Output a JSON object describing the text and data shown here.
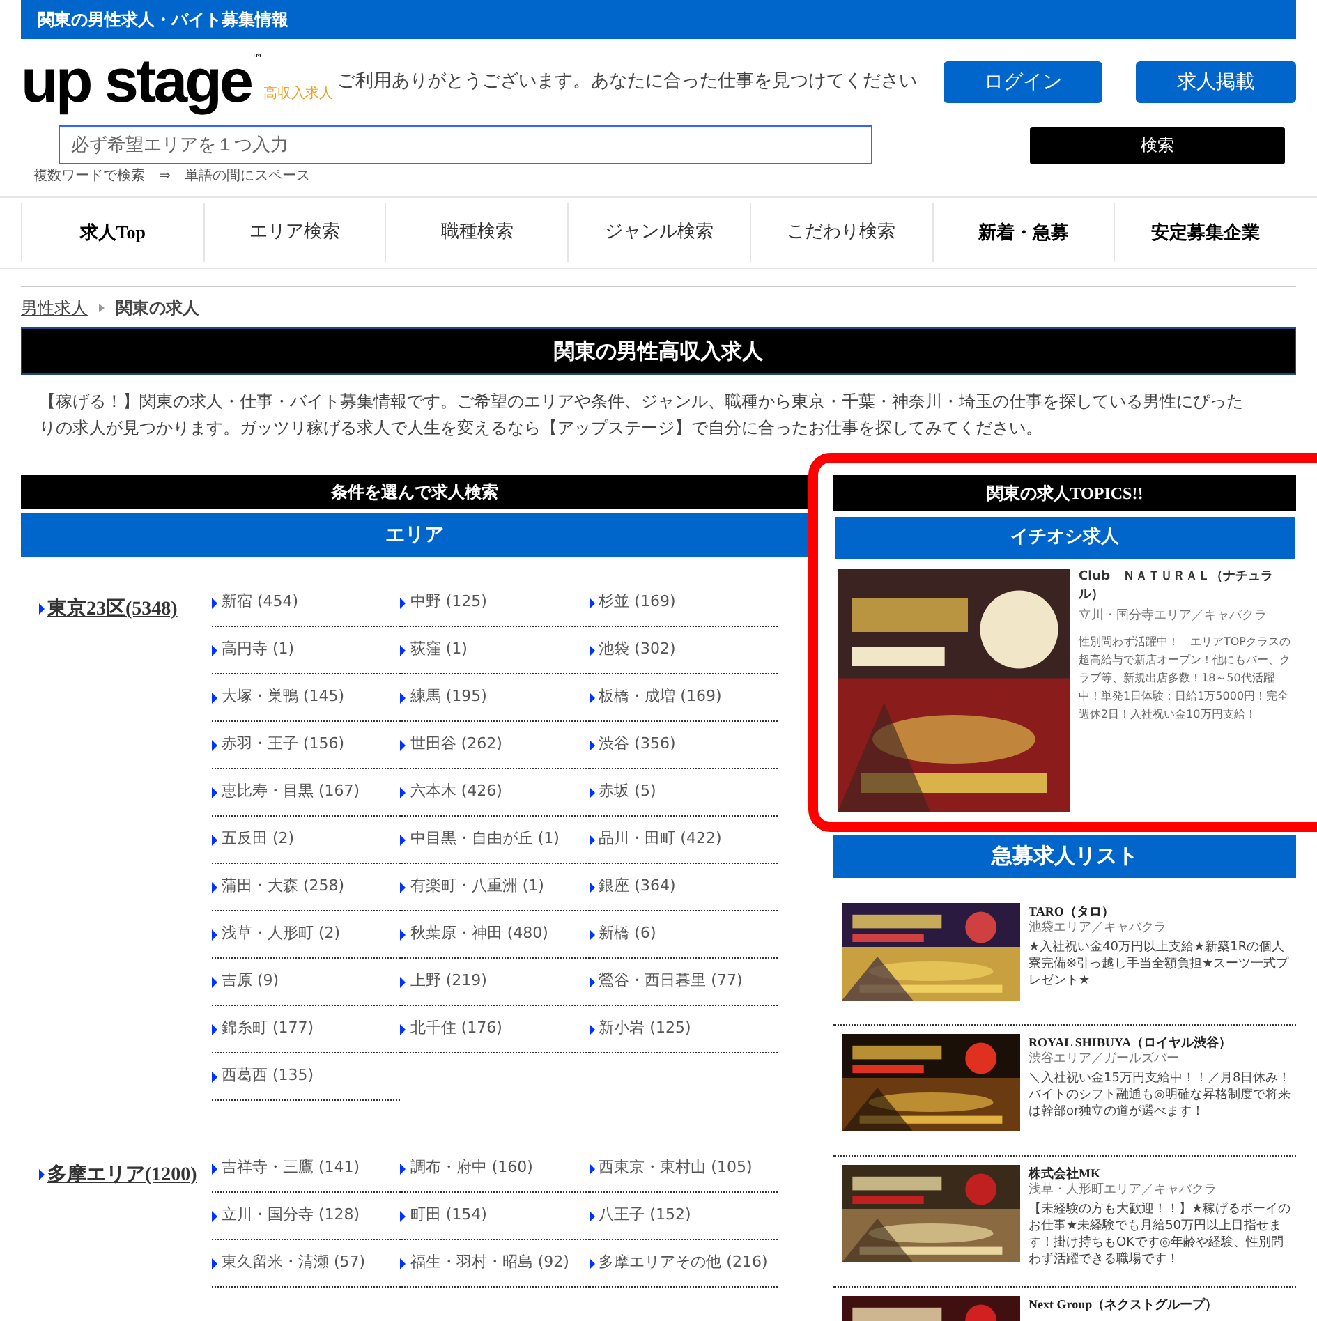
{
  "site_bar": {
    "title": "関東の男性求人・バイト募集情報"
  },
  "header": {
    "logo": "up stage",
    "logo_mark": "™",
    "logo_tag": "高収入求人",
    "greeting": "ご利用ありがとうございます。あなたに合った仕事を見つけてください",
    "buttons": [
      "ログイン",
      "求人掲載"
    ]
  },
  "search": {
    "placeholder": "必ず希望エリアを１つ入力",
    "button": "検索",
    "hint": "複数ワードで検索　⇒　単語の間にスペース"
  },
  "nav": [
    {
      "label": "求人Top",
      "emphasized": true
    },
    {
      "label": "エリア検索",
      "emphasized": false
    },
    {
      "label": "職種検索",
      "emphasized": false
    },
    {
      "label": "ジャンル検索",
      "emphasized": false
    },
    {
      "label": "こだわり検索",
      "emphasized": false
    },
    {
      "label": "新着・急募",
      "emphasized": true
    },
    {
      "label": "安定募集企業",
      "emphasized": true
    }
  ],
  "breadcrumb": [
    {
      "label": "男性求人",
      "link": true
    },
    {
      "label": "関東の求人",
      "link": false
    }
  ],
  "page_title": "関東の男性高収入求人",
  "description": "【稼げる！】関東の求人・仕事・バイト募集情報です。ご希望のエリアや条件、ジャンル、職種から東京・千葉・神奈川・埼玉の仕事を探している男性にぴったりの求人が見つかります。ガッツリ稼げる求人で人生を変えるなら【アップステージ】で自分に合ったお仕事を探してみてください。",
  "search_panel": {
    "title": "条件を選んで求人検索",
    "tab": "エリア",
    "regions": [
      {
        "name": "東京23区(5348)",
        "areas": [
          "新宿 (454)",
          "中野 (125)",
          "杉並 (169)",
          "高円寺 (1)",
          "荻窪 (1)",
          "池袋 (302)",
          "大塚・巣鴨 (145)",
          "練馬 (195)",
          "板橋・成増 (169)",
          "赤羽・王子 (156)",
          "世田谷 (262)",
          "渋谷 (356)",
          "恵比寿・目黒 (167)",
          "六本木 (426)",
          "赤坂 (5)",
          "五反田 (2)",
          "中目黒・自由が丘 (1)",
          "品川・田町 (422)",
          "蒲田・大森 (258)",
          "有楽町・八重洲 (1)",
          "銀座 (364)",
          "浅草・人形町 (2)",
          "秋葉原・神田 (480)",
          "新橋 (6)",
          "吉原 (9)",
          "上野 (219)",
          "鶯谷・西日暮里 (77)",
          "錦糸町 (177)",
          "北千住 (176)",
          "新小岩 (125)",
          "西葛西 (135)"
        ]
      },
      {
        "name": "多摩エリア(1200)",
        "areas": [
          "吉祥寺・三鷹 (141)",
          "調布・府中 (160)",
          "西東京・東村山 (105)",
          "立川・国分寺 (128)",
          "町田 (154)",
          "八王子 (152)",
          "東久留米・清瀬 (57)",
          "福生・羽村・昭島 (92)",
          "多摩エリアその他 (216)"
        ]
      }
    ]
  },
  "topics": {
    "title": "関東の求人TOPICS!!",
    "section": "イチオシ求人",
    "featured": {
      "name": "Club　ＮＡＴＵＲＡＬ（ナチュラル）",
      "area": "立川・国分寺エリア／キャバクラ",
      "text": "性別問わず活躍中！　エリアTOPクラスの超高給与で新店オープン！他にもバー、クラブ等、新規出店多数！18～50代活躍中！単発1日体験：日給1万5000円！完全週休2日！入社祝い金10万円支給！"
    }
  },
  "urgent": {
    "title": "急募求人リスト",
    "jobs": [
      {
        "name": "TARO（タロ）",
        "area": "池袋エリア／キャバクラ",
        "text": "★入社祝い金40万円以上支給★新築1Rの個人寮完備※引っ越し手当全額負担★スーツ一式プレゼント★"
      },
      {
        "name": "ROYAL SHIBUYA（ロイヤル渋谷）",
        "area": "渋谷エリア／ガールズバー",
        "text": "＼入社祝い金15万円支給中！！／月8日休み！バイトのシフト融通も◎明確な昇格制度で将来は幹部or独立の道が選べます！"
      },
      {
        "name": "株式会社MK",
        "area": "浅草・人形町エリア／キャバクラ",
        "text": "【未経験の方も大歓迎！！】★稼げるボーイのお仕事★未経験でも月給50万円以上目指せます！掛け持ちもOKです◎年齢や経験、性別問わず活躍できる職場です！"
      },
      {
        "name": "Next Group（ネクストグループ）"
      }
    ]
  }
}
